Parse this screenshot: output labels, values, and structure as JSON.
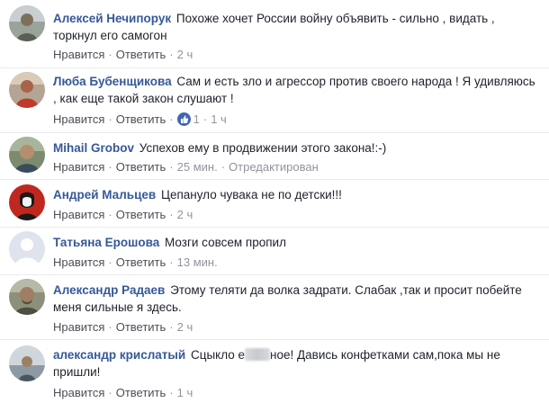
{
  "labels": {
    "like": "Нравится",
    "reply": "Ответить",
    "separator": "·"
  },
  "comments": [
    {
      "author": "Алексей Нечипорук",
      "text": "Похоже хочет России войну объявить - сильно , видать , торкнул его самогон",
      "time": "2 ч"
    },
    {
      "author": "Люба Бубенщикова",
      "text": "Сам и есть зло и агрессор против своего народа ! Я удивляюсь , как еще такой закон слушают !",
      "likes": "1",
      "time": "1 ч"
    },
    {
      "author": "Mihail Grobov",
      "text": "Успехов ему в продвижении этого закона!:-)",
      "time": "25 мин.",
      "edited": "Отредактирован"
    },
    {
      "author": "Андрей Мальцев",
      "text": "Цепануло чувака не по детски!!!",
      "time": "2 ч"
    },
    {
      "author": "Татьяна Ерошова",
      "text": "Мозги совсем пропил",
      "time": "13 мин."
    },
    {
      "author": "Александр Радаев",
      "text": "Этому теляти да волка задрати. Слабак ,так и просит побейте меня сильные я здесь.",
      "time": "2 ч"
    },
    {
      "author": "александр крислатый",
      "text_before": "Сцыкло е",
      "text_after": "ное! Давись конфетками сам,пока мы не пришли!",
      "time": "1 ч"
    }
  ],
  "colors": {
    "author": "#365899",
    "meta": "#90949c",
    "action": "#4b4f56",
    "like_badge": "#4267b2"
  }
}
